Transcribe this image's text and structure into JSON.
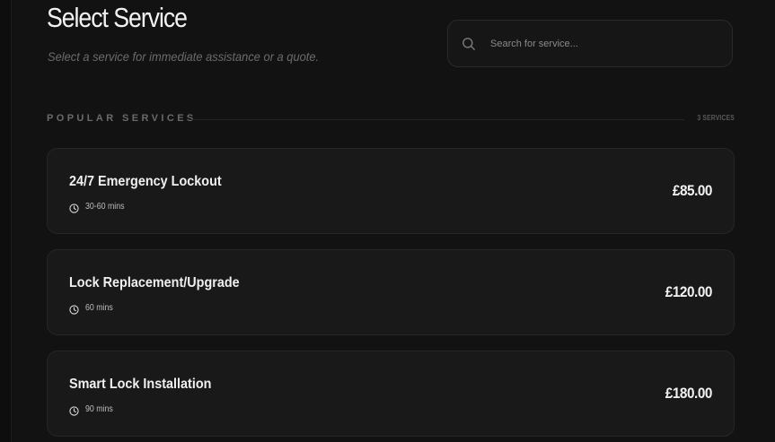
{
  "header": {
    "title": "Select Service",
    "subtitle": "Select a service for immediate assistance or a quote."
  },
  "search": {
    "placeholder": "Search for service...",
    "value": "",
    "icon": "search-icon"
  },
  "section": {
    "title": "POPULAR SERVICES",
    "count": "3 SERVICES"
  },
  "services": [
    {
      "name": "24/7 Emergency Lockout",
      "duration": "30-60 mins",
      "price": "£85.00",
      "icon": "clock-icon"
    },
    {
      "name": "Lock Replacement/Upgrade",
      "duration": "60 mins",
      "price": "£120.00",
      "icon": "clock-icon"
    },
    {
      "name": "Smart Lock Installation",
      "duration": "90 mins",
      "price": "£180.00",
      "icon": "clock-icon"
    }
  ],
  "colors": {
    "background": "#121212",
    "card_background": "#191919",
    "card_border": "#262626",
    "text_primary": "#f0f0f0",
    "text_muted": "#6b6b6b"
  }
}
